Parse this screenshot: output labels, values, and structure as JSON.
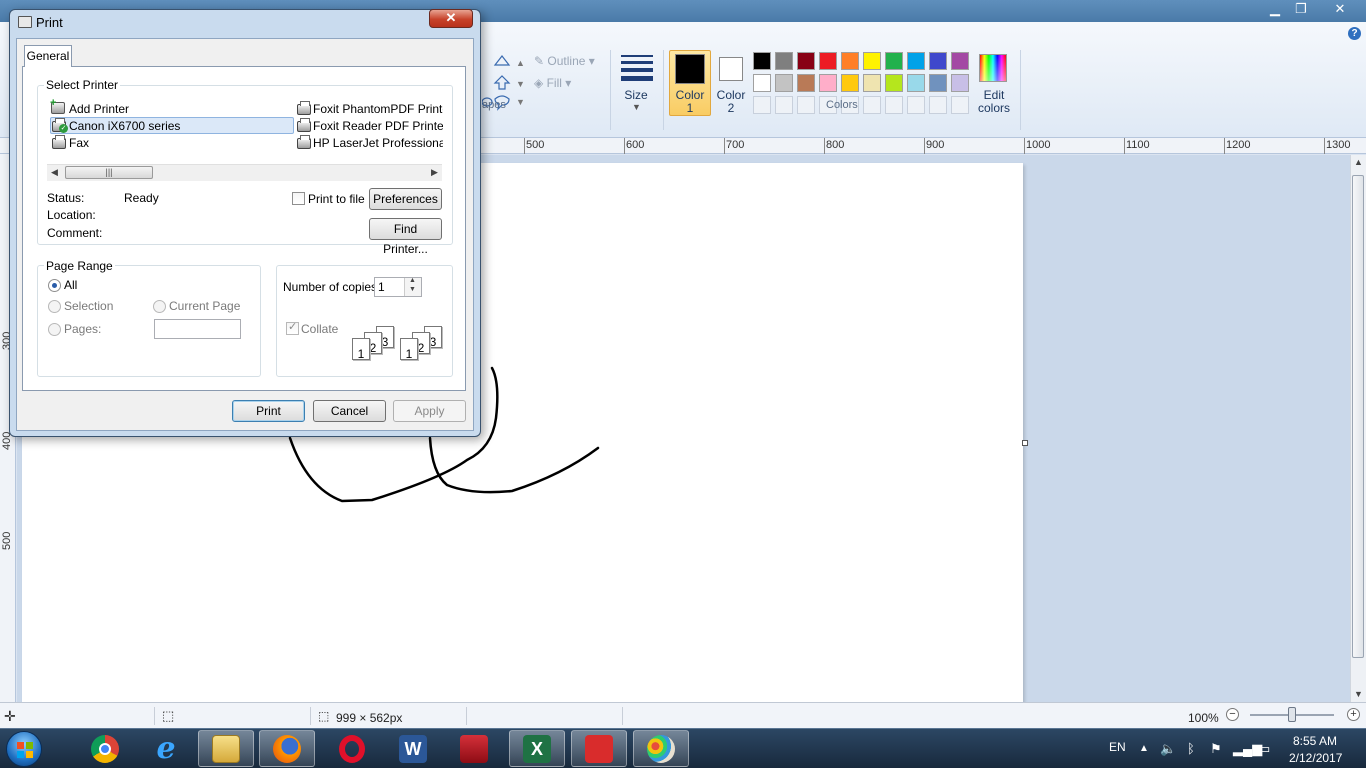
{
  "paint": {
    "window_controls": {
      "minimize": "▁",
      "restore": "❐",
      "close": "✕"
    },
    "help": "?",
    "ribbon": {
      "shapes_label": "apes",
      "outline_label": "Outline",
      "fill_label": "Fill",
      "size_label": "Size",
      "color1_label": "Color",
      "color1_num": "1",
      "color2_label": "Color",
      "color2_num": "2",
      "colors_group_label": "Colors",
      "edit_colors_label": "Edit",
      "edit_colors_label2": "colors",
      "palette_row1": [
        "#000000",
        "#7f7f7f",
        "#880015",
        "#ed1c24",
        "#ff7f27",
        "#fff200",
        "#22b14c",
        "#00a2e8",
        "#3f48cc",
        "#a349a4"
      ],
      "palette_row2": [
        "#ffffff",
        "#c3c3c3",
        "#b97a57",
        "#ffaec9",
        "#ffc90e",
        "#efe4b0",
        "#b5e61d",
        "#99d9ea",
        "#7092be",
        "#c8bfe7"
      ],
      "color1": "#000000",
      "color2": "#ffffff"
    },
    "ruler_h": [
      "500",
      "600",
      "700",
      "800",
      "900",
      "1000",
      "1100",
      "1200",
      "1300"
    ],
    "ruler_v": [
      "300",
      "400",
      "500"
    ],
    "statusbar": {
      "dimensions": "999 × 562px",
      "zoom": "100%",
      "zoom_level_percent": 100
    }
  },
  "dialog": {
    "title": "Print",
    "close": "✕",
    "tab": "General",
    "select_printer": {
      "title": "Select Printer",
      "col1": [
        "Add Printer",
        "Canon iX6700 series",
        "Fax"
      ],
      "col2": [
        "Foxit PhantomPDF Printe",
        "Foxit Reader PDF Printer",
        "HP LaserJet Professional"
      ],
      "selected": "Canon iX6700 series"
    },
    "status_label": "Status:",
    "status_value": "Ready",
    "location_label": "Location:",
    "comment_label": "Comment:",
    "print_to_file": "Print to file",
    "preferences": "Preferences",
    "find_printer": "Find Printer...",
    "page_range": {
      "title": "Page Range",
      "all": "All",
      "selection": "Selection",
      "current_page": "Current Page",
      "pages": "Pages:"
    },
    "copies_label": "Number of copies:",
    "copies_value": "1",
    "collate": "Collate",
    "collate_pages": [
      "1",
      "2",
      "3"
    ],
    "buttons": {
      "print": "Print",
      "cancel": "Cancel",
      "apply": "Apply"
    }
  },
  "taskbar": {
    "language": "EN",
    "time": "8:55 AM",
    "date": "2/12/2017",
    "apps": [
      "chrome-icon",
      "internet-explorer-icon",
      "file-explorer-icon",
      "firefox-icon",
      "opera-icon",
      "word-icon",
      "acrobat-icon",
      "excel-icon",
      "recorder-icon",
      "paint-icon"
    ]
  }
}
